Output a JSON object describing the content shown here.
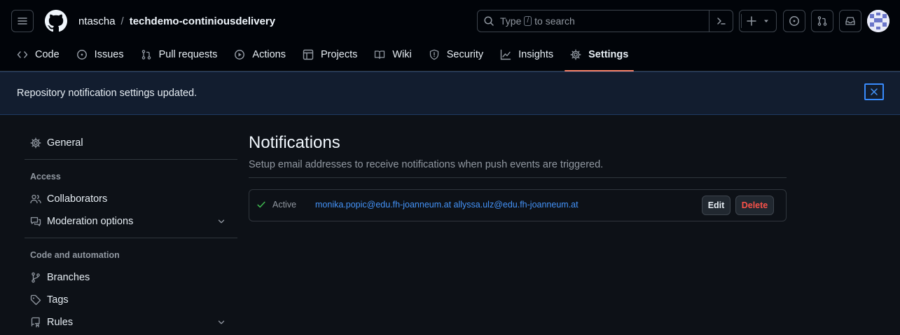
{
  "header": {
    "owner": "ntascha",
    "separator": "/",
    "repo": "techdemo-continiousdelivery",
    "search": {
      "prefix": "Type",
      "key": "/",
      "suffix": "to search"
    }
  },
  "tabs": [
    {
      "label": "Code",
      "icon": "code-icon"
    },
    {
      "label": "Issues",
      "icon": "issue-opened-icon"
    },
    {
      "label": "Pull requests",
      "icon": "git-pull-request-icon"
    },
    {
      "label": "Actions",
      "icon": "play-icon"
    },
    {
      "label": "Projects",
      "icon": "table-icon"
    },
    {
      "label": "Wiki",
      "icon": "book-icon"
    },
    {
      "label": "Security",
      "icon": "shield-icon"
    },
    {
      "label": "Insights",
      "icon": "graph-icon"
    },
    {
      "label": "Settings",
      "icon": "gear-icon",
      "active": true
    }
  ],
  "flash": {
    "message": "Repository notification settings updated."
  },
  "sidebar": {
    "general": "General",
    "access_heading": "Access",
    "collaborators": "Collaborators",
    "moderation": "Moderation options",
    "automation_heading": "Code and automation",
    "branches": "Branches",
    "tags": "Tags",
    "rules": "Rules"
  },
  "main": {
    "title": "Notifications",
    "description": "Setup email addresses to receive notifications when push events are triggered.",
    "hook": {
      "status": "Active",
      "emails": "monika.popic@edu.fh-joanneum.at allyssa.ulz@edu.fh-joanneum.at",
      "edit_label": "Edit",
      "delete_label": "Delete"
    }
  },
  "colors": {
    "background": "#0d1117",
    "header_bg": "#010409",
    "accent_underline": "#f78166",
    "link": "#4493f8",
    "danger": "#f85149",
    "success": "#3fb950"
  }
}
